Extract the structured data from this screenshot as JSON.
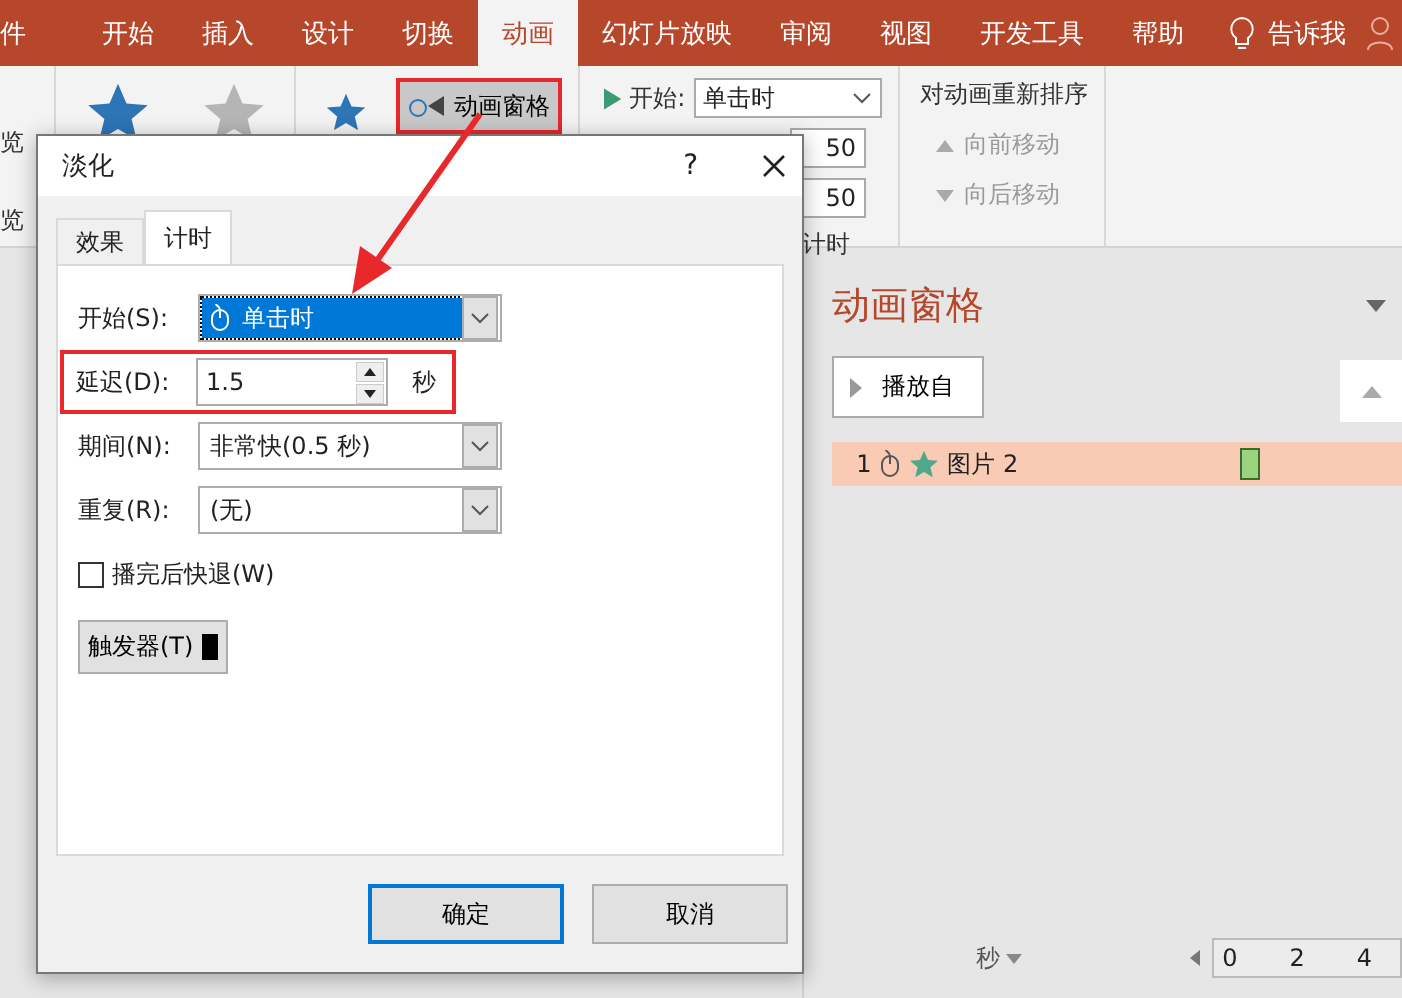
{
  "ribbon_tabs": [
    {
      "label": "件",
      "selected": false
    },
    {
      "label": "开始",
      "selected": false
    },
    {
      "label": "插入",
      "selected": false
    },
    {
      "label": "设计",
      "selected": false
    },
    {
      "label": "切换",
      "selected": false
    },
    {
      "label": "动画",
      "selected": true
    },
    {
      "label": "幻灯片放映",
      "selected": false
    },
    {
      "label": "审阅",
      "selected": false
    },
    {
      "label": "视图",
      "selected": false
    },
    {
      "label": "开发工具",
      "selected": false
    },
    {
      "label": "帮助",
      "selected": false
    }
  ],
  "tell_me": "告诉我",
  "ribbon": {
    "preview_button": "览",
    "preview_group": "览",
    "animation_pane_button": {
      "label": "动画窗格",
      "highlighted": true
    },
    "timing": {
      "start_label": "开始:",
      "start_value": "单击时",
      "duration_value": "50",
      "delay_value": "50",
      "group_label": "计时"
    },
    "reorder": {
      "title": "对动画重新排序",
      "move_earlier": "向前移动",
      "move_later": "向后移动",
      "disabled": true
    }
  },
  "dialog": {
    "title": "淡化",
    "help": "?",
    "tabs": [
      {
        "label": "效果",
        "selected": false
      },
      {
        "label": "计时",
        "selected": true
      }
    ],
    "fields": [
      {
        "kind": "combo",
        "label": "开始(S):",
        "value": "单击时",
        "focused": true,
        "highlighted": false
      },
      {
        "kind": "spin",
        "label": "延迟(D):",
        "value": "1.5",
        "unit": "秒",
        "focused": false,
        "highlighted": true
      },
      {
        "kind": "combo",
        "label": "期间(N):",
        "value": "非常快(0.5 秒)",
        "focused": false,
        "highlighted": false
      },
      {
        "kind": "combo",
        "label": "重复(R):",
        "value": "(无)",
        "focused": false,
        "highlighted": false
      }
    ],
    "rewind": {
      "label": "播完后快退(W)",
      "checked": false
    },
    "trigger_button": "触发器(T)",
    "ok_button": "确定",
    "cancel_button": "取消"
  },
  "animation_pane": {
    "title": "动画窗格",
    "play_button": "播放自",
    "items": [
      {
        "number": "1",
        "name": "图片 2",
        "selected": true
      }
    ],
    "time_unit": "秒",
    "ruler": [
      "0",
      "2",
      "4"
    ]
  }
}
